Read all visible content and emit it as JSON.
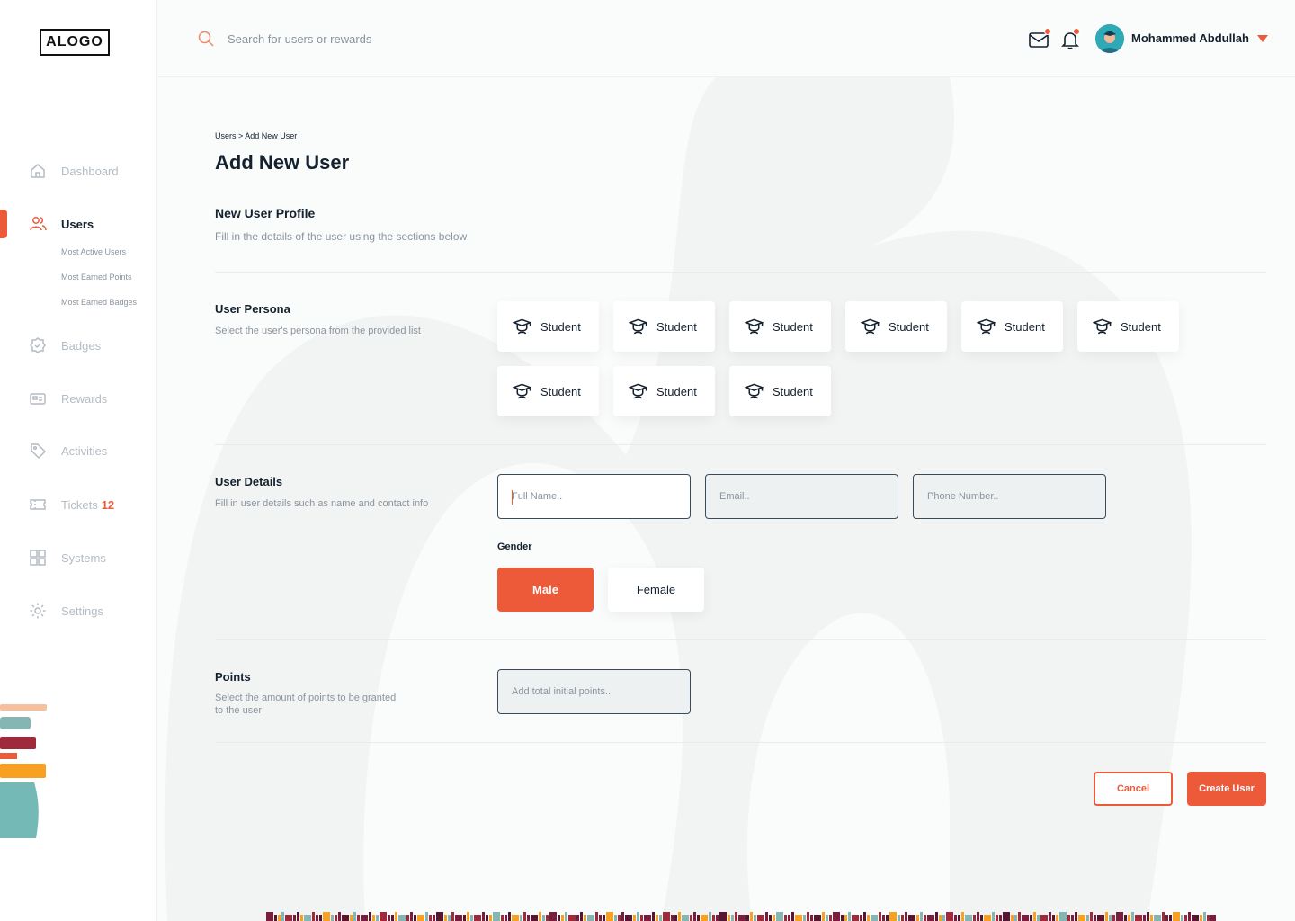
{
  "brand": {
    "logo_text": "ALOGO",
    "accent": "#ec5a3a"
  },
  "sidebar": {
    "items": [
      {
        "label": "Dashboard",
        "icon": "home-icon"
      },
      {
        "label": "Users",
        "icon": "users-icon",
        "active": true
      },
      {
        "label": "Badges",
        "icon": "badge-check-icon"
      },
      {
        "label": "Rewards",
        "icon": "reward-card-icon"
      },
      {
        "label": "Activities",
        "icon": "tag-icon"
      },
      {
        "label": "Tickets",
        "icon": "ticket-icon",
        "count": "12"
      },
      {
        "label": "Systems",
        "icon": "grid-icon"
      },
      {
        "label": "Settings",
        "icon": "gear-icon"
      }
    ],
    "sub_items": [
      "Most Active Users",
      "Most Earned Points",
      "Most Earned Badges"
    ]
  },
  "topbar": {
    "search_placeholder": "Search for users or rewards",
    "user_name": "Mohammed Abdullah"
  },
  "page": {
    "breadcrumb": "Users > Add New User",
    "title": "Add New User",
    "profile_title": "New User Profile",
    "profile_desc": "Fill in the details of the user using the sections below"
  },
  "persona": {
    "title": "User Persona",
    "desc": "Select the user's persona from the provided list",
    "options": [
      "Student",
      "Student",
      "Student",
      "Student",
      "Student",
      "Student",
      "Student",
      "Student",
      "Student"
    ]
  },
  "details": {
    "title": "User Details",
    "desc": "Fill in user details such as name and contact info",
    "full_name_placeholder": "Full Name..",
    "email_placeholder": "Email..",
    "phone_placeholder": "Phone Number..",
    "gender_label": "Gender",
    "gender_options": [
      "Male",
      "Female"
    ],
    "gender_selected": "Male"
  },
  "points": {
    "title": "Points",
    "desc_line1": "Select the amount of points to be granted",
    "desc_line2": "to the user",
    "placeholder": "Add total initial points.."
  },
  "actions": {
    "cancel": "Cancel",
    "create": "Create User"
  }
}
